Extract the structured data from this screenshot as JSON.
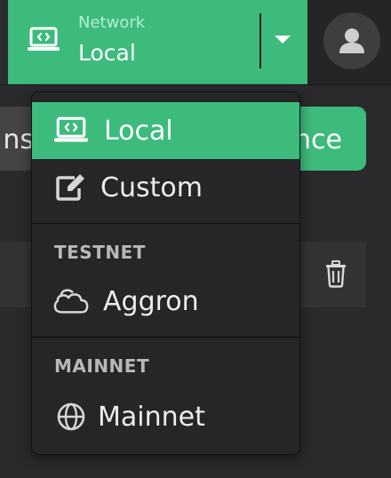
{
  "header": {
    "network_label": "Network",
    "network_value": "Local",
    "network_icon": "laptop-code-icon",
    "caret_icon": "caret-down-icon",
    "avatar_icon": "user-icon"
  },
  "background": {
    "left_button_text": "ns",
    "right_button_text": "nce",
    "row_icon": "trash-icon"
  },
  "dropdown": {
    "items": [
      {
        "label": "Local",
        "icon": "laptop-code-icon",
        "active": true
      },
      {
        "label": "Custom",
        "icon": "edit-icon",
        "active": false
      }
    ],
    "sections": [
      {
        "heading": "TESTNET",
        "items": [
          {
            "label": "Aggron",
            "icon": "cloud-icon"
          }
        ]
      },
      {
        "heading": "MAINNET",
        "items": [
          {
            "label": "Mainnet",
            "icon": "globe-icon"
          }
        ]
      }
    ]
  },
  "colors": {
    "accent": "#3dbb7c",
    "background": "#2a2a2c",
    "menu_background": "#262628"
  }
}
